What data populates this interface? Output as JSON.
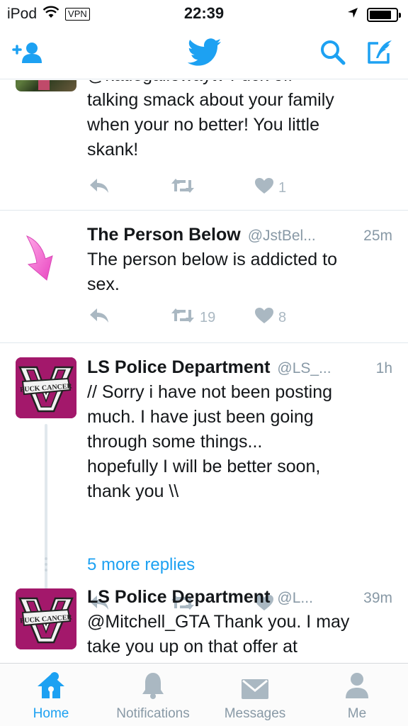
{
  "status_bar": {
    "carrier": "iPod",
    "vpn": "VPN",
    "time": "22:39"
  },
  "nav": {
    "logo": "twitter-bird-icon",
    "left_icon": "add-user-icon",
    "right_icons": [
      "search-icon",
      "compose-icon"
    ]
  },
  "colors": {
    "accent": "#1da1f2",
    "muted": "#8899a6",
    "action": "#aab8c2",
    "avatar_magenta": "#a3186b"
  },
  "tweets": [
    {
      "name": "",
      "handle": "",
      "time": "",
      "text_lines": [
        "@katiegallowaytv Fuck off",
        "talking smack about your family",
        "when your no better! You little",
        "skank!"
      ],
      "retweets": "",
      "likes": "1"
    },
    {
      "name": "The Person Below",
      "handle": "@JstBel...",
      "time": "25m",
      "text_lines": [
        "The person below is addicted to",
        "sex."
      ],
      "retweets": "19",
      "likes": "8"
    },
    {
      "name": "LS Police Department",
      "handle": "@LS_...",
      "time": "1h",
      "text_lines": [
        "// Sorry i have not been posting",
        "much. I have just been going",
        "through some things...",
        "hopefully I will be better soon,",
        "thank you \\\\"
      ],
      "retweets": "",
      "likes": "",
      "avatar_text": "FUCK CANCER"
    },
    {
      "name": "LS Police Department",
      "handle": "@L...",
      "time": "39m",
      "text_lines": [
        "@Mitchell_GTA Thank you. I may",
        "take you up on that offer at"
      ],
      "avatar_text": "FUCK CANCER"
    }
  ],
  "more_replies": "5 more replies",
  "tabs": [
    {
      "label": "Home",
      "icon": "home-icon",
      "active": true
    },
    {
      "label": "Notifications",
      "icon": "bell-icon",
      "active": false
    },
    {
      "label": "Messages",
      "icon": "envelope-icon",
      "active": false
    },
    {
      "label": "Me",
      "icon": "person-icon",
      "active": false
    }
  ]
}
